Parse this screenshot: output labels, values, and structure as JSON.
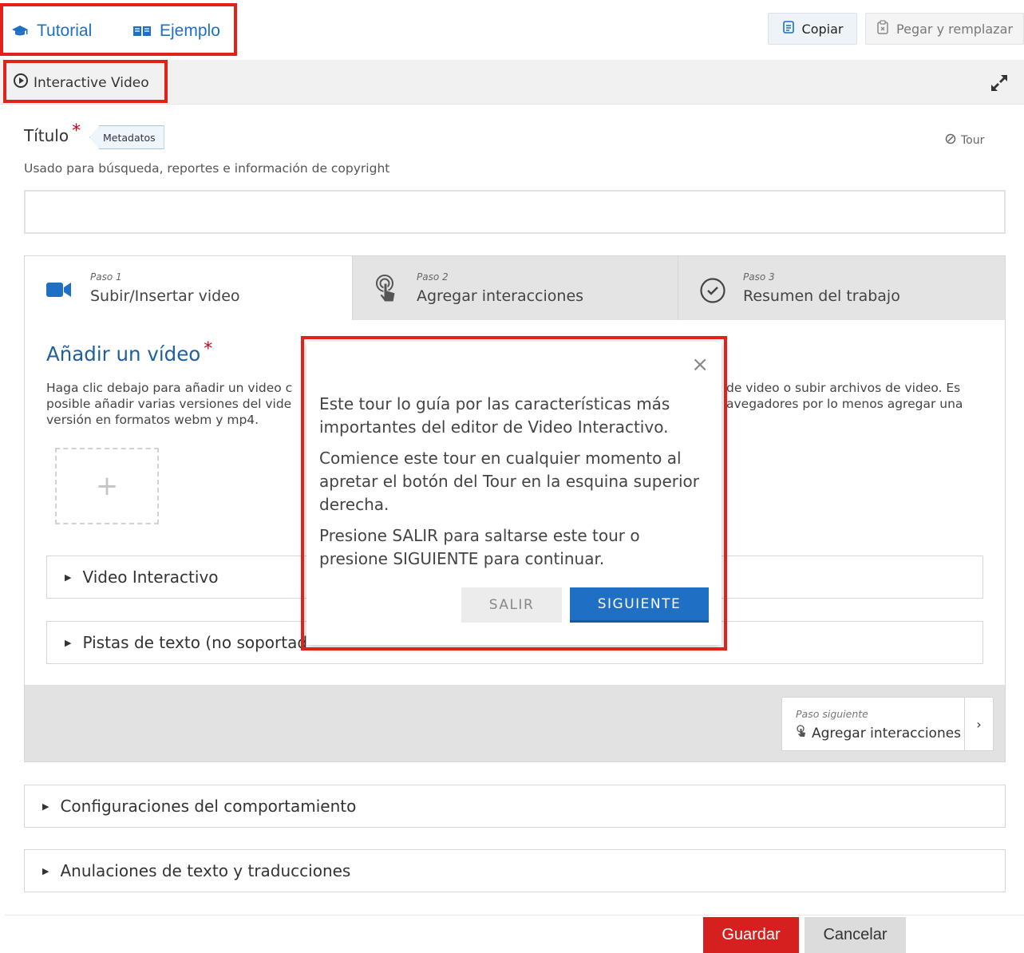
{
  "top_links": {
    "tutorial": "Tutorial",
    "example": "Ejemplo"
  },
  "toolbar": {
    "copy": "Copiar",
    "paste_replace": "Pegar y remplazar"
  },
  "content_type": {
    "title": "Interactive Video"
  },
  "title_field": {
    "label": "Título",
    "required_mark": "*",
    "metadata_tag": "Metadatos",
    "tour_link": "Tour",
    "description": "Usado para búsqueda, reportes e información de copyright",
    "value": ""
  },
  "wizard": {
    "steps": [
      {
        "number": "Paso 1",
        "title": "Subir/Insertar video",
        "icon": "video-camera-icon"
      },
      {
        "number": "Paso 2",
        "title": "Agregar interacciones",
        "icon": "touch-icon"
      },
      {
        "number": "Paso 3",
        "title": "Resumen del trabajo",
        "icon": "check-circle-icon"
      }
    ],
    "section_title": "Añadir un vídeo",
    "section_required": "*",
    "section_desc_line1_left": "Haga clic debajo para añadir un video c",
    "section_desc_line1_right": "de video o subir archivos de video. Es",
    "section_desc_line2_left": "posible añadir varias versiones del vide",
    "section_desc_line2_right": "avegadores por lo menos agregar una",
    "section_desc_line3": "versión en formatos webm y mp4.",
    "upload_symbol": "+",
    "collapsibles": [
      {
        "label": "Video Interactivo"
      },
      {
        "label": "Pistas de texto (no soportad"
      }
    ],
    "next_step": {
      "label": "Paso siguiente",
      "title": "Agregar interacciones",
      "arrow": "›"
    }
  },
  "outer_sections": [
    {
      "label": "Configuraciones del comportamiento"
    },
    {
      "label": "Anulaciones de texto y traducciones"
    }
  ],
  "footer": {
    "save": "Guardar",
    "cancel": "Cancelar"
  },
  "tour_popup": {
    "close": "×",
    "paragraphs": [
      "Este tour lo guía por las características más importantes del editor de Video Interactivo.",
      "Comience este tour en cualquier momento al apretar el botón del Tour en la esquina superior derecha.",
      "Presione SALIR para saltarse este tour o presione SIGUIENTE para continuar."
    ],
    "exit": "SALIR",
    "next": "SIGUIENTE"
  },
  "colors": {
    "accent": "#1f6fc5",
    "annotation_red": "#e0221b",
    "save_red": "#d61f1f",
    "section_title": "#1f5f9e"
  }
}
